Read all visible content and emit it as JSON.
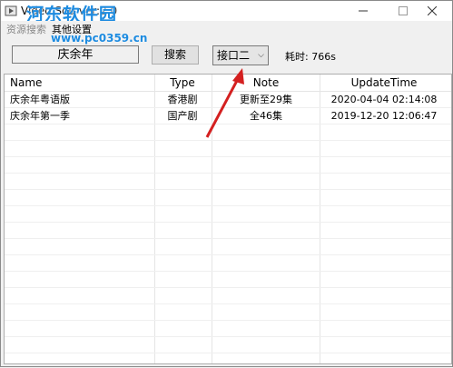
{
  "window": {
    "title": "Video Sou ver:2.0",
    "watermark": "河东软件园",
    "watermark_url": "www.pc0359.cn"
  },
  "menu": {
    "items": [
      "资源搜索",
      "其他设置"
    ]
  },
  "toolbar": {
    "search_value": "庆余年",
    "search_button": "搜索",
    "api_selected": "接口二",
    "elapsed_label": "耗时:",
    "elapsed_value": "766s"
  },
  "table": {
    "columns": [
      "Name",
      "Type",
      "Note",
      "UpdateTime"
    ],
    "rows": [
      {
        "name": "庆余年粤语版",
        "type": "香港剧",
        "note": "更新至29集",
        "time": "2020-04-04 02:14:08"
      },
      {
        "name": "庆余年第一季",
        "type": "国产剧",
        "note": "全46集",
        "time": "2019-12-20 12:06:47"
      }
    ]
  },
  "colors": {
    "arrow": "#d42020",
    "watermark": "#1d8be0"
  }
}
